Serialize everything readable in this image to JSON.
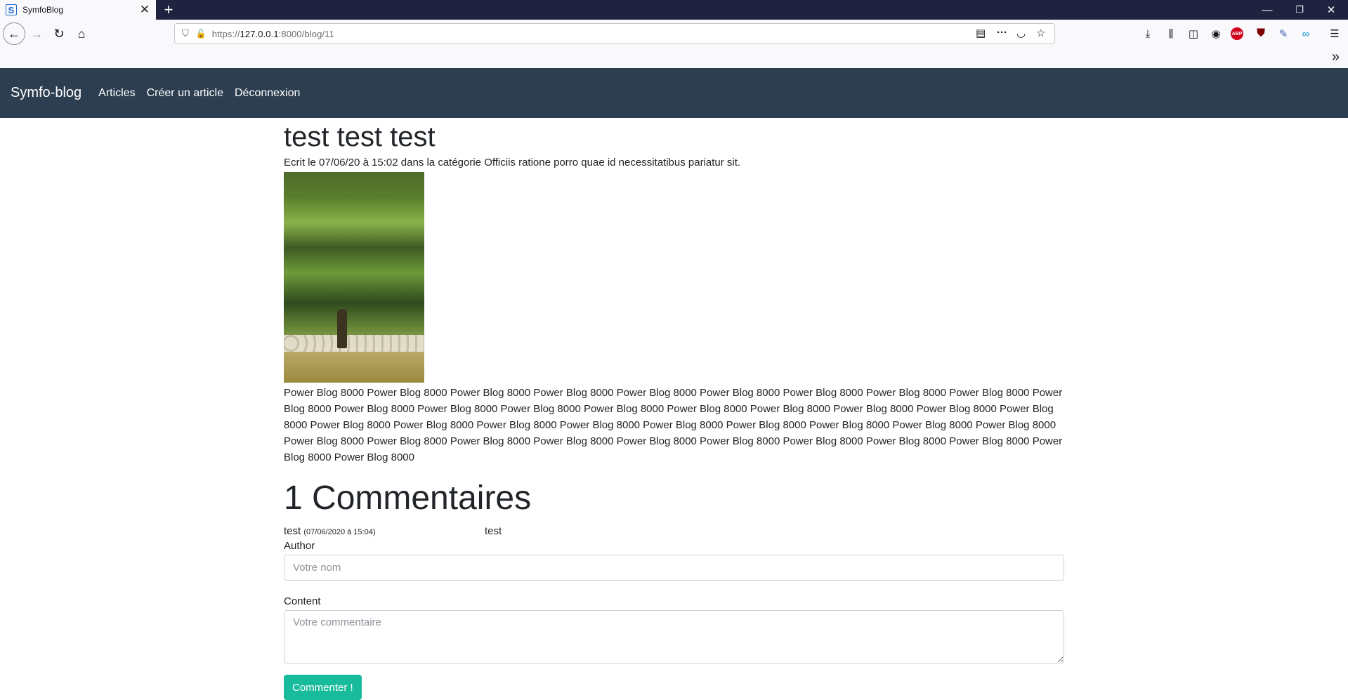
{
  "browser": {
    "tab_title": "SymfoBlog",
    "new_tab": "+",
    "close_tab": "✕",
    "url_prefix": "https://",
    "url_host": "127.0.0.1",
    "url_path": ":8000/blog/11",
    "window_controls": {
      "minimize": "—",
      "restore": "❐",
      "close": "✕"
    }
  },
  "site_nav": {
    "brand": "Symfo-blog",
    "links": [
      "Articles",
      "Créer un article",
      "Déconnexion"
    ]
  },
  "article": {
    "title": "test test test",
    "meta": "Ecrit le 07/06/20 à 15:02 dans la catégorie Officiis ratione porro quae id necessitatibus pariatur sit.",
    "body": "Power Blog 8000 Power Blog 8000 Power Blog 8000 Power Blog 8000 Power Blog 8000 Power Blog 8000 Power Blog 8000 Power Blog 8000 Power Blog 8000 Power Blog 8000 Power Blog 8000 Power Blog 8000 Power Blog 8000 Power Blog 8000 Power Blog 8000 Power Blog 8000 Power Blog 8000 Power Blog 8000 Power Blog 8000 Power Blog 8000 Power Blog 8000 Power Blog 8000 Power Blog 8000 Power Blog 8000 Power Blog 8000 Power Blog 8000 Power Blog 8000 Power Blog 8000 Power Blog 8000 Power Blog 8000 Power Blog 8000 Power Blog 8000 Power Blog 8000 Power Blog 8000 Power Blog 8000 Power Blog 8000 Power Blog 8000 Power Blog 8000 Power Blog 8000"
  },
  "comments": {
    "title": "1 Commentaires",
    "items": [
      {
        "author": "test",
        "date": "(07/06/2020 à 15:04)",
        "content": "test"
      }
    ]
  },
  "form": {
    "author_label": "Author",
    "author_placeholder": "Votre nom",
    "content_label": "Content",
    "content_placeholder": "Votre commentaire",
    "submit_label": "Commenter !"
  },
  "colors": {
    "browser_tabbar": "#202340",
    "site_navbar": "#2c3e50",
    "submit_button": "#18bc9c"
  }
}
